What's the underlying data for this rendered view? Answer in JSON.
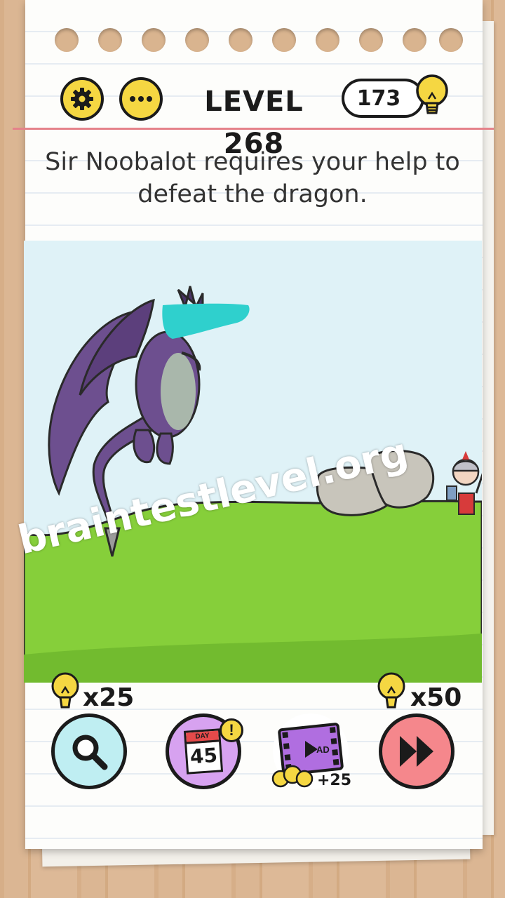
{
  "header": {
    "level_label": "LEVEL 268",
    "hint_count": "173"
  },
  "question": {
    "line1": "Sir Noobalot requires your help to",
    "line2": "defeat the dragon."
  },
  "watermark": "braintestlevel.org",
  "bottom": {
    "hint_cost": "x25",
    "skip_cost": "x50",
    "daily_day_label": "DAY",
    "daily_day_number": "45",
    "daily_badge": "!",
    "ad_label": "AD",
    "ad_reward": "+25"
  },
  "colors": {
    "accent_yellow": "#f5d742",
    "sky": "#dff2f7",
    "grass": "#86cf3a",
    "hint_button": "#bfeef2",
    "daily_button": "#d7a2f0",
    "skip_button": "#f5878c",
    "margin_line": "#e5828a"
  },
  "icons": [
    "gear-icon",
    "more-icon",
    "lightbulb-icon",
    "magnifier-icon",
    "calendar-icon",
    "film-icon",
    "fast-forward-icon"
  ]
}
